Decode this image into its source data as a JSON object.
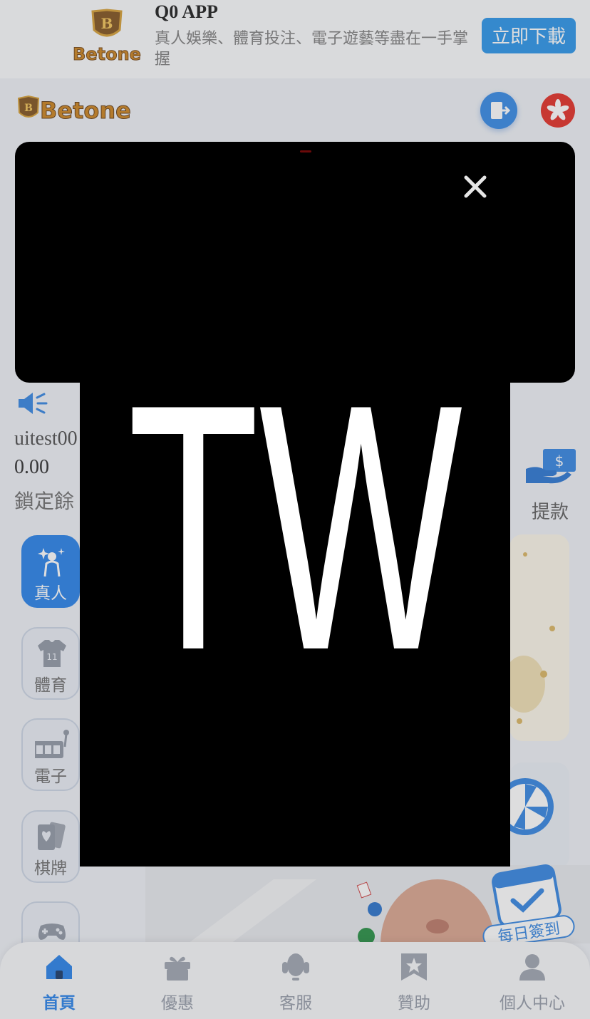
{
  "app_banner": {
    "title": "Q0 APP",
    "description": "真人娛樂、體育投注、電子遊藝等盡在一手掌握",
    "download_label": "立即下載",
    "logo_text": "Betone"
  },
  "header": {
    "logo_text": "Betone"
  },
  "account": {
    "username": "uitest00",
    "balance": "0.00",
    "locked_balance_label": "鎖定餘",
    "withdraw_label": "提款"
  },
  "categories": [
    {
      "label": "真人",
      "icon": "live-dealer-icon",
      "active": true
    },
    {
      "label": "體育",
      "icon": "jersey-icon",
      "active": false
    },
    {
      "label": "電子",
      "icon": "slot-machine-icon",
      "active": false
    },
    {
      "label": "棋牌",
      "icon": "cards-icon",
      "active": false
    },
    {
      "label": "",
      "icon": "gamepad-icon",
      "active": false
    }
  ],
  "promo": {
    "daily_checkin_label": "每日簽到"
  },
  "popup": {
    "image_text": "TW"
  },
  "bottom_nav": [
    {
      "label": "首頁",
      "icon": "home-icon",
      "active": true
    },
    {
      "label": "優惠",
      "icon": "gift-icon",
      "active": false
    },
    {
      "label": "客服",
      "icon": "headset-icon",
      "active": false
    },
    {
      "label": "贊助",
      "icon": "sponsor-icon",
      "active": false
    },
    {
      "label": "個人中心",
      "icon": "user-icon",
      "active": false
    }
  ],
  "colors": {
    "accent": "#1c7be8",
    "download_button": "#1f8fe8",
    "popup_background": "#000000"
  }
}
